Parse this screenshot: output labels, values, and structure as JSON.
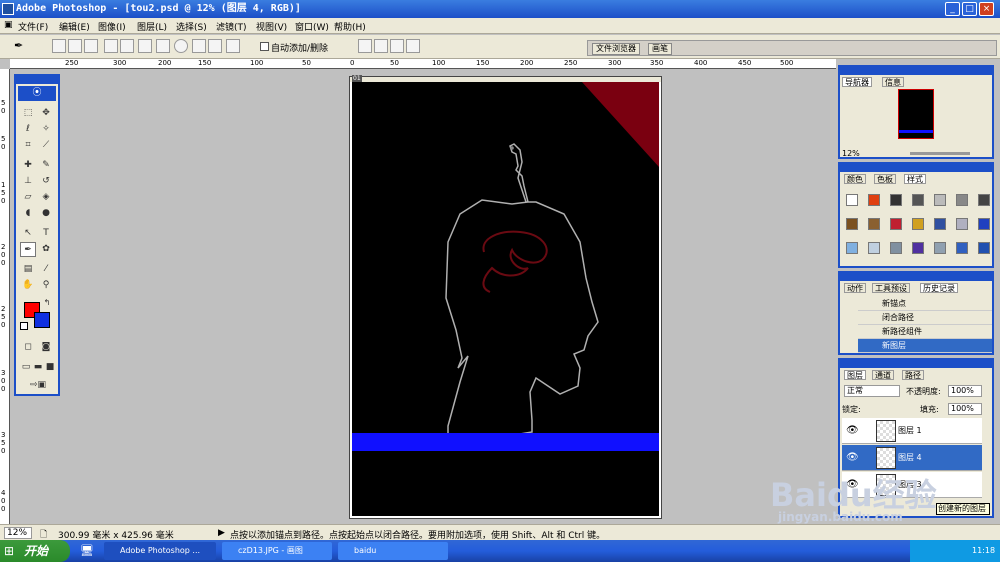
{
  "app": {
    "title": "Adobe Photoshop - [tou2.psd @ 12% (图层 4, RGB)]"
  },
  "window_buttons": {
    "minimize": "_",
    "maximize": "□",
    "close": "×"
  },
  "menu": [
    "文件(F)",
    "编辑(E)",
    "图像(I)",
    "图层(L)",
    "选择(S)",
    "滤镜(T)",
    "视图(V)",
    "窗口(W)",
    "帮助(H)"
  ],
  "options": {
    "auto_add_delete": "自动添加/删除",
    "tab_file_browser": "文件浏览器",
    "tab_brushes": "画笔"
  },
  "ruler": {
    "h_ticks": [
      "250",
      "300",
      "200",
      "150",
      "100",
      "50",
      "0",
      "50",
      "100",
      "150",
      "200",
      "250",
      "300",
      "350",
      "400",
      "450",
      "500"
    ],
    "v_ticks": [
      "5",
      "0",
      "5",
      "0",
      "1",
      "5",
      "0",
      "2",
      "0",
      "0",
      "2",
      "5",
      "0",
      "3",
      "0",
      "0",
      "3",
      "5",
      "0",
      "4",
      "0",
      "0"
    ]
  },
  "document": {
    "frame": "01"
  },
  "status": {
    "zoom": "12%",
    "doc_size": "300.99 毫米 x 425.96 毫米",
    "hint": "点按以添加锚点到路径。点按起始点以闭合路径。要用附加选项，使用 Shift、Alt 和 Ctrl 键。"
  },
  "navigator": {
    "tabs": [
      "导航器",
      "信息"
    ],
    "zoom": "12%"
  },
  "color_panel": {
    "tabs": [
      "颜色",
      "色板",
      "样式"
    ]
  },
  "history_panel": {
    "tabs": [
      "动作",
      "工具预设",
      "历史记录"
    ],
    "items": [
      "新锚点",
      "闭合路径",
      "新路径组件",
      "新图层"
    ]
  },
  "layers_panel": {
    "tabs": [
      "图层",
      "通道",
      "路径"
    ],
    "blend_mode": "正常",
    "opacity_label": "不透明度:",
    "opacity": "100%",
    "lock_label": "锁定:",
    "fill_label": "填充:",
    "fill": "100%",
    "layers": [
      "图层 1",
      "图层 4",
      "图层 3"
    ],
    "footer_tooltip": "创建新的图层"
  },
  "taskbar": {
    "start": "开始",
    "tasks": [
      "Adobe Photoshop ...",
      "czD13.JPG - 画图",
      "baidu"
    ],
    "clock": "11:18"
  },
  "watermark": {
    "line1": "Baidu经验",
    "line2": "jingyan.baidu.com"
  },
  "colors": {
    "foreground": "#ff0000",
    "background": "#1030e0",
    "titlebar": "#1c4fc8",
    "blue_band": "#1010ff",
    "red_corner": "#7a0010"
  }
}
